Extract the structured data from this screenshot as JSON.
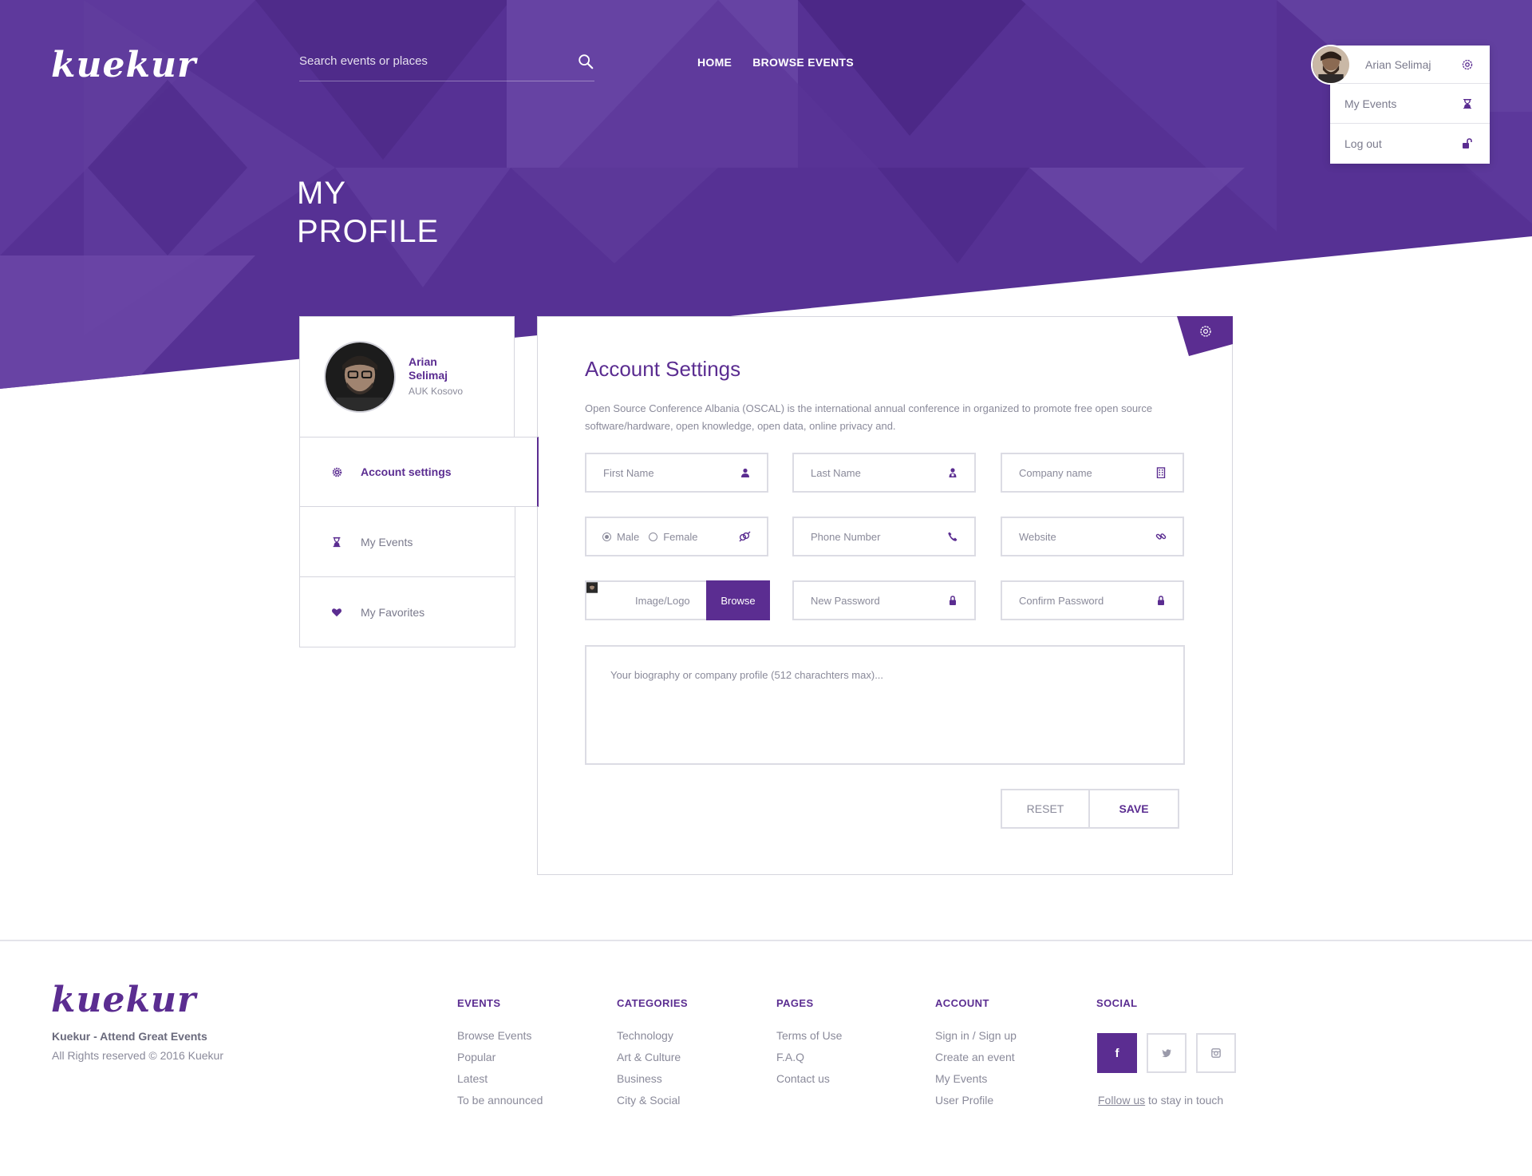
{
  "brand": {
    "logo_text": "kuekur",
    "accent": "#5b2d91",
    "hero_color": "#5a3596"
  },
  "header": {
    "search_placeholder": "Search events or places",
    "nav": [
      "HOME",
      "BROWSE EVENTS"
    ],
    "user": {
      "name": "Arian Selimaj",
      "menu": [
        {
          "label": "My Events",
          "icon": "hourglass-icon"
        },
        {
          "label": "Log out",
          "icon": "unlock-icon"
        }
      ]
    }
  },
  "page_title": {
    "line1": "MY",
    "line2": "PROFILE"
  },
  "profile": {
    "name": "Arian Selimaj",
    "org": "AUK Kosovo"
  },
  "sidebar": {
    "items": [
      {
        "label": "Account settings",
        "icon": "gear-icon",
        "active": true
      },
      {
        "label": "My Events",
        "icon": "hourglass-icon"
      },
      {
        "label": "My Favorites",
        "icon": "heart-icon"
      }
    ]
  },
  "settings": {
    "title": "Account Settings",
    "description": "Open Source Conference Albania (OSCAL) is the international annual conference in organized to promote free open source software/hardware, open knowledge, open data, online privacy and.",
    "fields": {
      "first_name": "First Name",
      "last_name": "Last Name",
      "company": "Company name",
      "gender_male": "Male",
      "gender_female": "Female",
      "gender_selected": "Male",
      "phone": "Phone Number",
      "website": "Website",
      "image": "Image/Logo",
      "browse": "Browse",
      "new_password": "New Password",
      "confirm_password": "Confirm Password",
      "bio": "Your biography or company profile (512 charachters max)..."
    },
    "buttons": {
      "reset": "RESET",
      "save": "SAVE"
    }
  },
  "footer": {
    "tagline": "Kuekur - Attend Great Events",
    "copyright": "All Rights reserved © 2016 Kuekur",
    "columns": [
      {
        "title": "EVENTS",
        "links": [
          "Browse Events",
          "Popular",
          "Latest",
          "To be announced"
        ]
      },
      {
        "title": "CATEGORIES",
        "links": [
          "Technology",
          "Art & Culture",
          "Business",
          "City & Social"
        ]
      },
      {
        "title": "PAGES",
        "links": [
          "Terms of Use",
          "F.A.Q",
          "Contact us"
        ]
      },
      {
        "title": "ACCOUNT",
        "links": [
          "Sign in / Sign up",
          "Create an event",
          "My Events",
          "User Profile"
        ]
      }
    ],
    "social": {
      "title": "SOCIAL",
      "icons": [
        "facebook-icon",
        "twitter-icon",
        "instagram-icon"
      ],
      "follow_link": "Follow us",
      "follow_text": "to stay in touch"
    }
  }
}
